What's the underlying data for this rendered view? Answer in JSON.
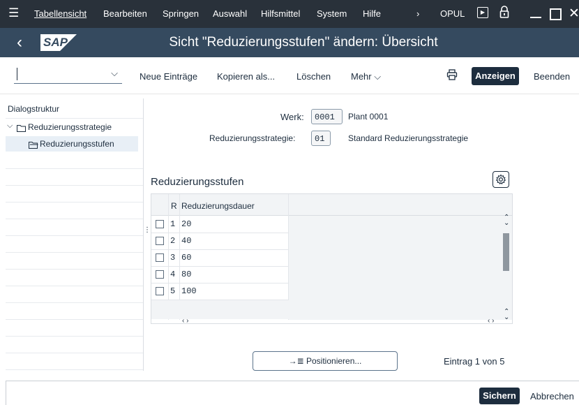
{
  "menubar": {
    "items": [
      "Tabellensicht",
      "Bearbeiten",
      "Springen",
      "Auswahl",
      "Hilfsmittel",
      "System",
      "Hilfe"
    ],
    "system_id": "OPUL"
  },
  "title": {
    "text": "Sicht \"Reduzierungsstufen\" ändern: Übersicht",
    "logo": "SAP"
  },
  "toolbar": {
    "new_entries": "Neue Einträge",
    "copy_as": "Kopieren als...",
    "delete": "Löschen",
    "more": "Mehr",
    "display": "Anzeigen",
    "exit": "Beenden"
  },
  "dialog_structure": {
    "title": "Dialogstruktur",
    "items": [
      {
        "label": "Reduzierungsstrategie"
      },
      {
        "label": "Reduzierungsstufen",
        "selected": true
      }
    ]
  },
  "header_fields": {
    "werk_label": "Werk:",
    "werk_value": "0001",
    "werk_text": "Plant 0001",
    "strategy_label": "Reduzierungsstrategie:",
    "strategy_value": "01",
    "strategy_text": "Standard Reduzierungsstrategie"
  },
  "table": {
    "title": "Reduzierungsstufen",
    "columns": [
      "R",
      "Reduzierungsdauer"
    ],
    "rows": [
      {
        "r": "1",
        "dauer": "20"
      },
      {
        "r": "2",
        "dauer": "40"
      },
      {
        "r": "3",
        "dauer": "60"
      },
      {
        "r": "4",
        "dauer": "80"
      },
      {
        "r": "5",
        "dauer": "100"
      }
    ]
  },
  "positioning": {
    "button": "Positionieren...",
    "entry_info": "Eintrag 1 von 5"
  },
  "footer": {
    "save": "Sichern",
    "cancel": "Abbrechen"
  }
}
